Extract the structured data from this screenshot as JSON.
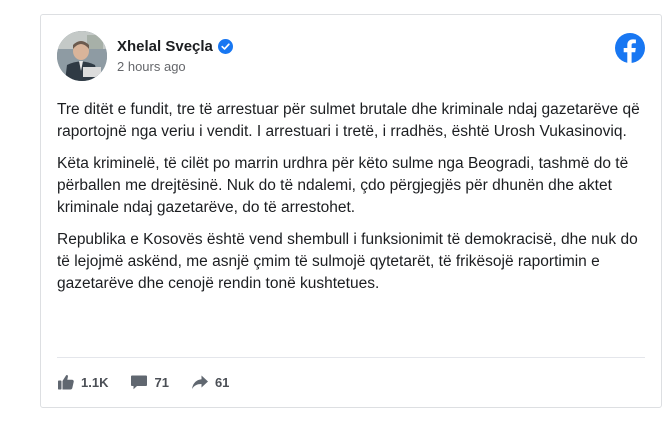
{
  "post": {
    "author": "Xhelal Sveçla",
    "timestamp": "2 hours ago",
    "paragraphs": [
      "Tre ditët e fundit, tre të arrestuar për sulmet brutale dhe kriminale ndaj gazetarëve që raportojnë nga veriu i vendit. I arrestuari i tretë, i rradhës, është Urosh Vukasinoviq.",
      "Këta kriminelë, të cilët po marrin urdhra për këto sulme nga Beogradi, tashmë do të përballen me drejtësinë. Nuk do të ndalemi, çdo përgjegjës për dhunën dhe aktet kriminale ndaj gazetarëve, do të arrestohet.",
      "Republika e Kosovës është vend shembull i funksionimit të demokracisë, dhe nuk do të lejojmë askënd, me asnjë çmim të sulmojë qytetarët, të frikësojë raportimin e gazetarëve dhe cenojë rendin tonë kushtetues."
    ]
  },
  "stats": {
    "likes": "1.1K",
    "comments": "71",
    "shares": "61"
  },
  "icons": {
    "verified": "verified-badge-icon",
    "brand": "facebook-logo-icon",
    "like": "thumbs-up-icon",
    "comment": "comment-icon",
    "share": "share-arrow-icon"
  },
  "colors": {
    "facebook_blue": "#1877f2",
    "verified_blue": "#1877f2",
    "text_primary": "#1c1e21",
    "text_secondary": "#65676b",
    "action_gray": "#4b4f56"
  }
}
